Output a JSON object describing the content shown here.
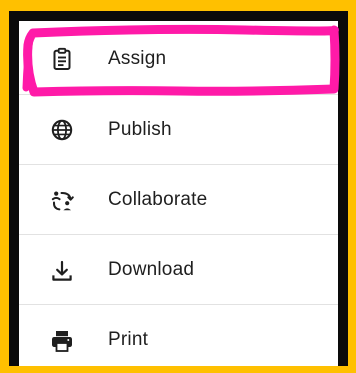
{
  "colors": {
    "page_background": "#FFC000",
    "frame": "#0A0A0A",
    "menu_background": "#FFFFFF",
    "text": "#1F1F1F",
    "divider": "#E2E2E2",
    "annotation": "#FF1AA8"
  },
  "menu": {
    "items": [
      {
        "label": "Assign",
        "icon": "clipboard-assignment-icon",
        "highlighted": true
      },
      {
        "label": "Publish",
        "icon": "globe-icon"
      },
      {
        "label": "Collaborate",
        "icon": "collaborate-icon"
      },
      {
        "label": "Download",
        "icon": "download-icon"
      },
      {
        "label": "Print",
        "icon": "print-icon"
      }
    ]
  },
  "annotation": {
    "type": "hand-drawn-highlight",
    "target": "Assign"
  }
}
